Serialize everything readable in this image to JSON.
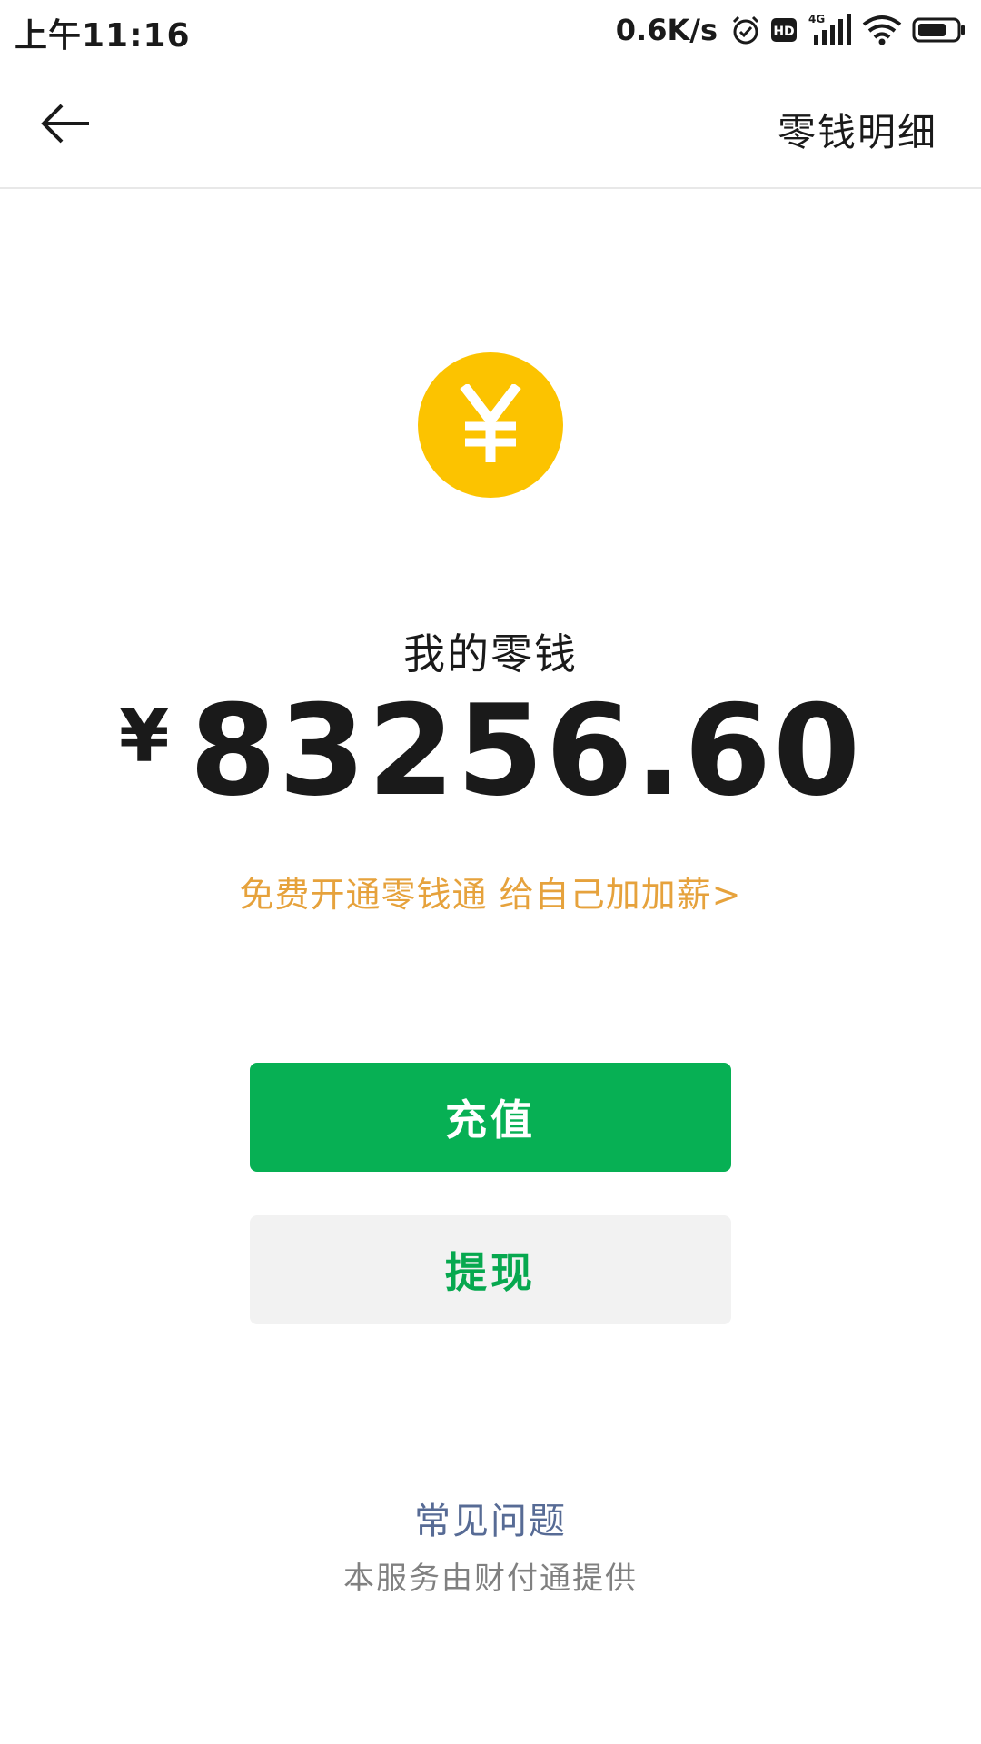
{
  "status_bar": {
    "time": "上午11:16",
    "network_speed": "0.6K/s",
    "icons": [
      "alarm-icon",
      "hd-icon",
      "signal-4g-icon",
      "wifi-icon",
      "battery-icon"
    ],
    "network_type": "4G",
    "hd_label": "HD"
  },
  "nav": {
    "back_icon": "arrow-left-icon",
    "detail_label": "零钱明细"
  },
  "wallet": {
    "coin_icon": "yuan-coin-icon",
    "coin_color": "#fcc300",
    "label": "我的零钱",
    "currency_symbol": "¥",
    "balance": "83256.60",
    "promo": "免费开通零钱通 给自己加加薪>"
  },
  "actions": {
    "recharge_label": "充值",
    "withdraw_label": "提现"
  },
  "footer": {
    "faq_label": "常见问题",
    "service_note": "本服务由财付通提供"
  },
  "colors": {
    "primary_green": "#07b054",
    "promo_orange": "#e6a23c",
    "link_blue": "#576b95"
  }
}
